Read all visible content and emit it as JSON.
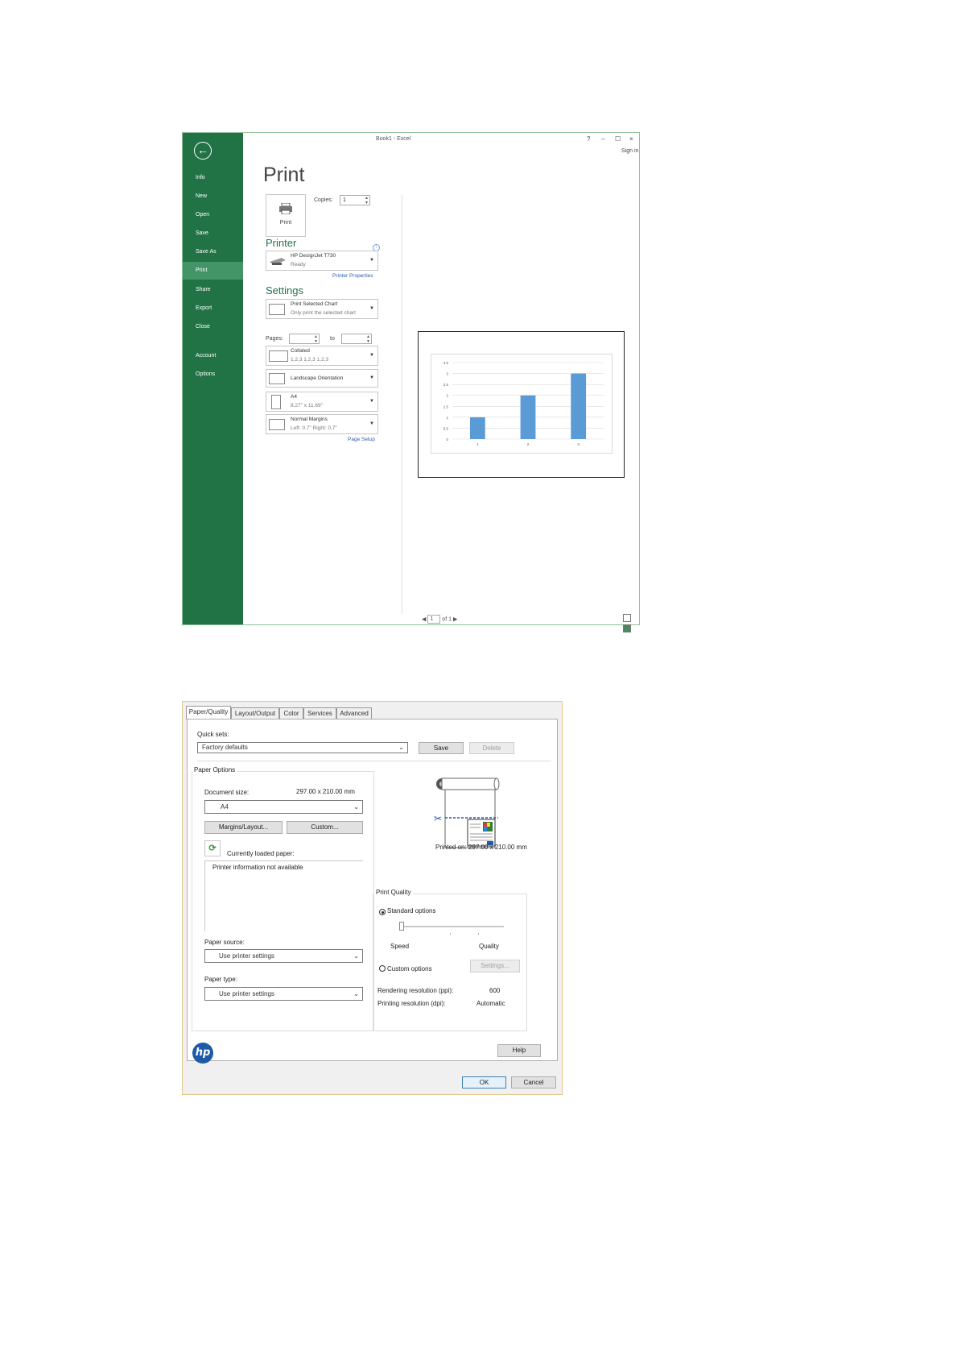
{
  "excel": {
    "window_title": "Book1 - Excel",
    "help_btn": "?",
    "minimize_btn": "–",
    "maximize_btn": "☐",
    "close_btn": "×",
    "sign_in": "Sign in",
    "back_icon": "←",
    "nav": [
      {
        "label": "Info",
        "active": false
      },
      {
        "label": "New",
        "active": false
      },
      {
        "label": "Open",
        "active": false
      },
      {
        "label": "Save",
        "active": false
      },
      {
        "label": "Save As",
        "active": false
      },
      {
        "label": "Print",
        "active": true
      },
      {
        "label": "Share",
        "active": false
      },
      {
        "label": "Export",
        "active": false
      },
      {
        "label": "Close",
        "active": false
      },
      {
        "label": "Account",
        "active": false
      },
      {
        "label": "Options",
        "active": false
      }
    ],
    "heading": "Print",
    "print_button_label": "Print",
    "copies_label": "Copies:",
    "copies_value": "1",
    "printer_section": "Printer",
    "printer": {
      "name": "HP DesignJet T730",
      "status": "Ready"
    },
    "printer_properties_link": "Printer Properties",
    "settings_section": "Settings",
    "settings": {
      "what": {
        "line1": "Print Selected Chart",
        "line2": "Only print the selected chart"
      },
      "pages_label": "Pages:",
      "pages_to": "to",
      "collation": {
        "line1": "Collated",
        "line2": "1,2,3   1,2,3   1,2,3"
      },
      "orientation": {
        "line1": "Landscape Orientation",
        "line2": ""
      },
      "paper": {
        "line1": "A4",
        "line2": "8.27\" x 11.69\""
      },
      "margins": {
        "line1": "Normal Margins",
        "line2": "Left: 0.7\"   Right: 0.7\""
      }
    },
    "page_setup_link": "Page Setup",
    "page_nav": {
      "current": "1",
      "of_label": "of 1"
    }
  },
  "chart_data": {
    "type": "bar",
    "categories": [
      "1",
      "2",
      "3"
    ],
    "values": [
      1,
      2,
      3
    ],
    "ylim": [
      0,
      3.5
    ],
    "yticks": [
      "0",
      "0.5",
      "1",
      "1.5",
      "2",
      "2.5",
      "3",
      "3.5"
    ],
    "grid": true,
    "bar_color": "#5b9bd5"
  },
  "dialog": {
    "tabs": [
      "Paper/Quality",
      "Layout/Output",
      "Color",
      "Services",
      "Advanced"
    ],
    "active_tab": "Paper/Quality",
    "quick_sets_label": "Quick sets:",
    "quick_sets_value": "Factory defaults",
    "save_btn": "Save",
    "delete_btn": "Delete",
    "paper_options_title": "Paper Options",
    "document_size_label": "Document size:",
    "document_size_value": "297.00 x 210.00 mm",
    "size_combo": "A4",
    "margins_btn": "Margins/Layout...",
    "custom_btn": "Custom...",
    "currently_loaded_label": "Currently loaded paper:",
    "printer_info": "Printer information not available",
    "paper_source_label": "Paper source:",
    "paper_source_value": "Use printer settings",
    "paper_type_label": "Paper type:",
    "paper_type_value": "Use printer settings",
    "printed_on": "Printed on: 297.00 x 210.00 mm",
    "print_quality_title": "Print Quality",
    "standard_options": "Standard options",
    "speed_label": "Speed",
    "quality_label": "Quality",
    "custom_options": "Custom options",
    "settings_btn": "Settings...",
    "rendering_label": "Rendering resolution (ppi):",
    "rendering_value": "600",
    "printing_label": "Printing resolution (dpi):",
    "printing_value": "Automatic",
    "hp_logo": "hp",
    "help_btn": "Help",
    "ok_btn": "OK",
    "cancel_btn": "Cancel",
    "quality_slider_level": 0
  }
}
